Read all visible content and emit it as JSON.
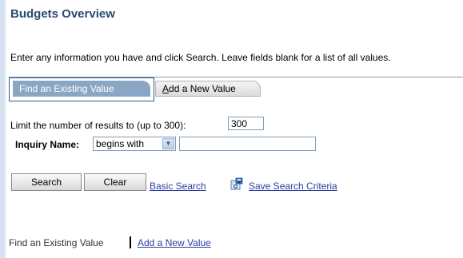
{
  "page": {
    "title": "Budgets Overview",
    "instruction": "Enter any information you have and click Search. Leave fields blank for a list of all values."
  },
  "tabs": {
    "find": "Find an Existing Value",
    "add_prefix": "A",
    "add_rest": "dd a New Value"
  },
  "form": {
    "limit_label": "Limit the number of results to (up to 300):",
    "limit_value": "300",
    "inquiry_label": "Inquiry Name:",
    "operator_value": "begins with",
    "inquiry_value": ""
  },
  "actions": {
    "search": "Search",
    "clear": "Clear",
    "basic_search": "Basic Search",
    "save_criteria": "Save Search Criteria"
  },
  "footer": {
    "find": "Find an Existing Value",
    "add": "Add a New Value"
  },
  "colors": {
    "title": "#2c4a74",
    "tab_active": "#8aa6c5",
    "link": "#2a3f9e"
  },
  "icons": {
    "save_criteria": "save-search-icon",
    "dropdown": "chevron-down-icon"
  }
}
